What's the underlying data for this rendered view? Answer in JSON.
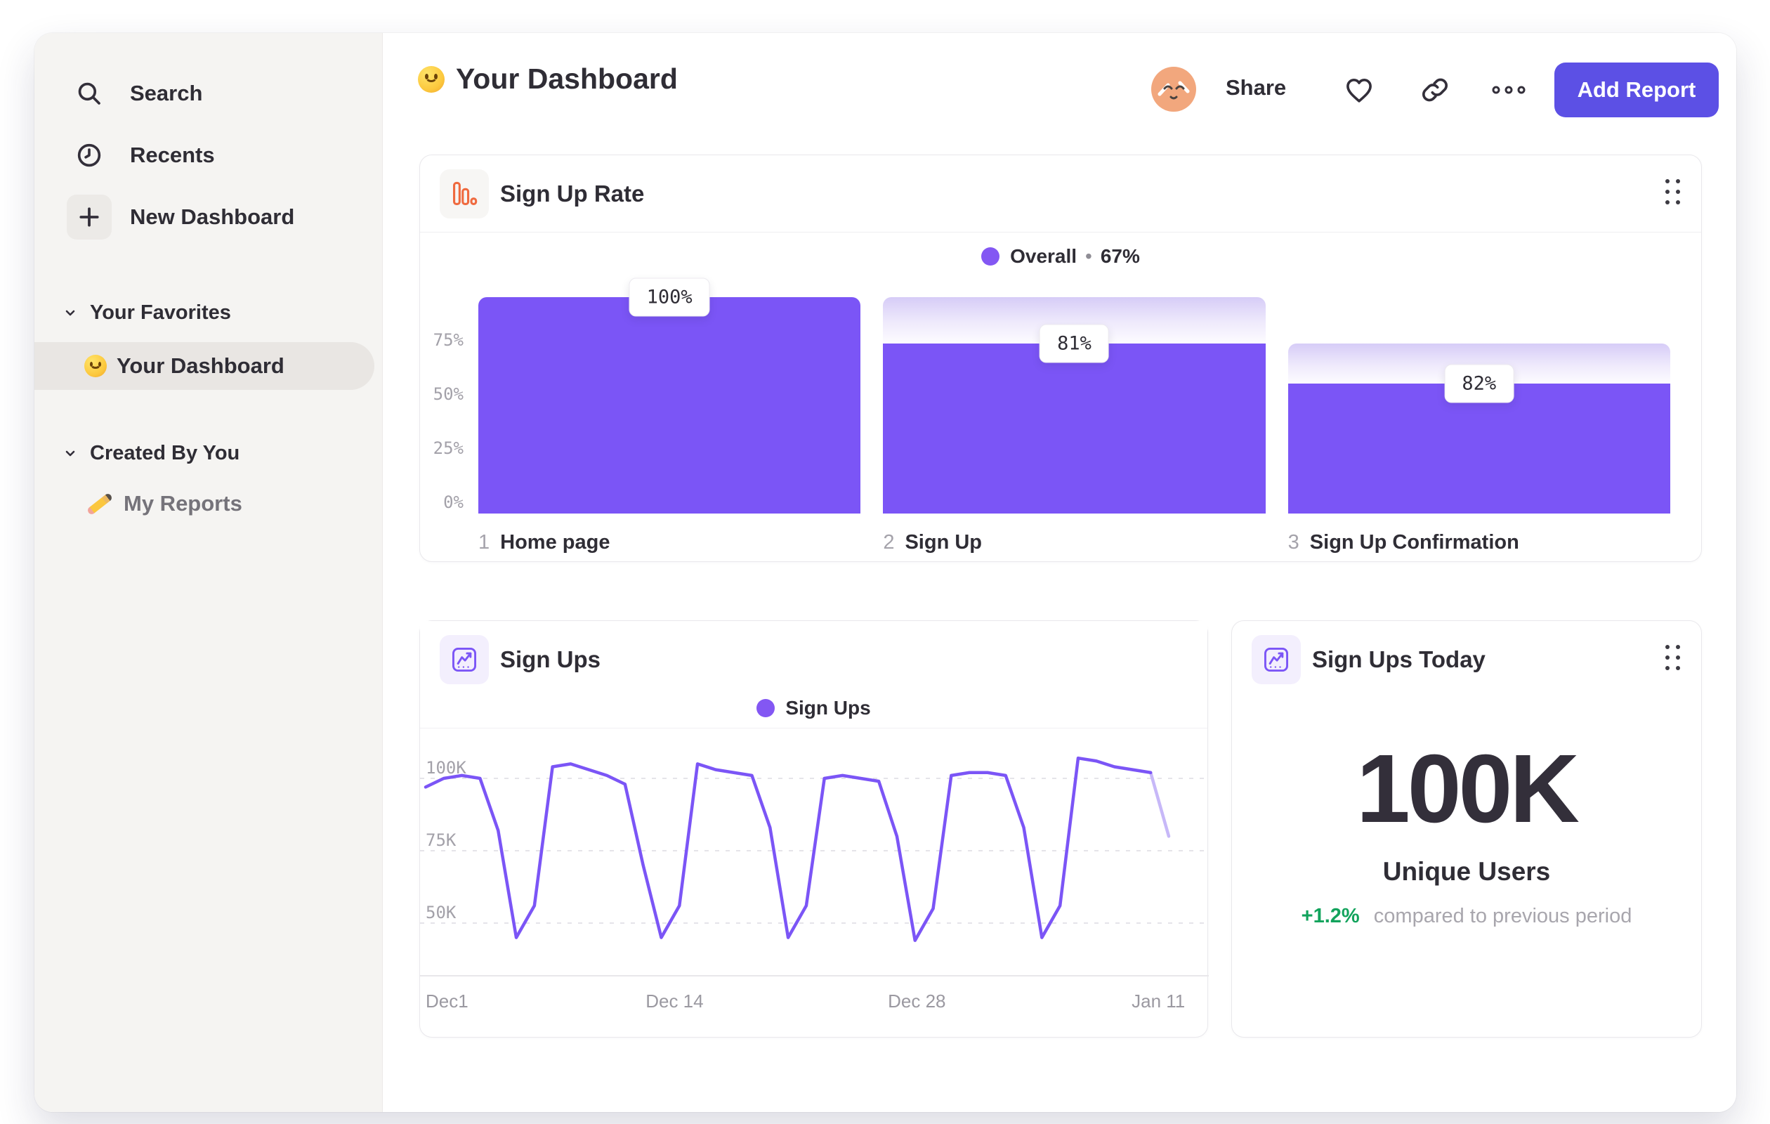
{
  "colors": {
    "accent_purple": "#7b55f6",
    "cap_gradient_top": "#d6ccf7",
    "button_purple": "#5c50e5",
    "icon_orange": "#ef6a3f",
    "delta_green": "#12a35c",
    "text_primary": "#2f2d35",
    "text_muted": "#a3a1a9"
  },
  "sidebar": {
    "nav": [
      {
        "icon": "search-icon",
        "label": "Search"
      },
      {
        "icon": "clock-icon",
        "label": "Recents"
      },
      {
        "icon": "plus-icon",
        "label": "New Dashboard"
      }
    ],
    "sections": [
      {
        "label": "Your Favorites",
        "items": [
          {
            "emoji": "slightly-smiling-face",
            "label": "Your Dashboard",
            "selected": true
          }
        ]
      },
      {
        "label": "Created By You",
        "items": [
          {
            "emoji": "pencil",
            "label": "My Reports",
            "selected": false
          }
        ]
      }
    ]
  },
  "header": {
    "emoji": "slightly-smiling-face",
    "title": "Your Dashboard",
    "share_label": "Share",
    "add_report_label": "Add Report"
  },
  "chart_data": [
    {
      "type": "bar",
      "subtype": "funnel",
      "title": "Sign Up Rate",
      "legend": {
        "series": "Overall",
        "separator": "•",
        "value": "67%"
      },
      "y_axis": {
        "labels": [
          "75%",
          "50%",
          "25%",
          "0%"
        ],
        "values": [
          75,
          50,
          25,
          0
        ]
      },
      "ylim": [
        0,
        100
      ],
      "grid": false,
      "steps": [
        {
          "n": "1",
          "label": "Home page",
          "tooltip": "100%",
          "conversion_from_previous_pct": 100,
          "solid_height_pct": 100,
          "cap_top_pct": 100
        },
        {
          "n": "2",
          "label": "Sign Up",
          "tooltip": "81%",
          "conversion_from_previous_pct": 81,
          "solid_height_pct": 78.5,
          "cap_top_pct": 100
        },
        {
          "n": "3",
          "label": "Sign Up Confirmation",
          "tooltip": "82%",
          "conversion_from_previous_pct": 82,
          "solid_height_pct": 60,
          "cap_top_pct": 78.5
        }
      ]
    },
    {
      "type": "line",
      "title": "Sign Ups",
      "legend": "Sign Ups",
      "unit": "K",
      "x_axis": {
        "labels": [
          "Dec1",
          "Dec 14",
          "Dec 28",
          "Jan 11"
        ],
        "label_fracs": [
          0,
          0.335,
          0.661,
          0.986
        ]
      },
      "y_axis": {
        "labels": [
          "100K",
          "75K",
          "50K"
        ],
        "values": [
          100,
          75,
          50
        ]
      },
      "ylim_k": [
        40,
        112
      ],
      "grid": "dashed-horizontal",
      "legend_position": "top-center",
      "values_k": [
        97,
        100,
        101,
        100,
        82,
        45,
        56,
        104,
        105,
        103,
        101,
        98,
        70,
        45,
        56,
        105,
        103,
        102,
        101,
        83,
        45,
        56,
        100,
        101,
        100,
        99,
        80,
        44,
        55,
        101,
        102,
        102,
        101,
        83,
        45,
        56,
        107,
        106,
        104,
        103,
        102,
        80
      ],
      "faded_tail_segments": 1
    },
    {
      "type": "stat",
      "title": "Sign Ups Today",
      "value": "100K",
      "label": "Unique Users",
      "delta": "+1.2%",
      "delta_note": "compared to previous period"
    }
  ]
}
